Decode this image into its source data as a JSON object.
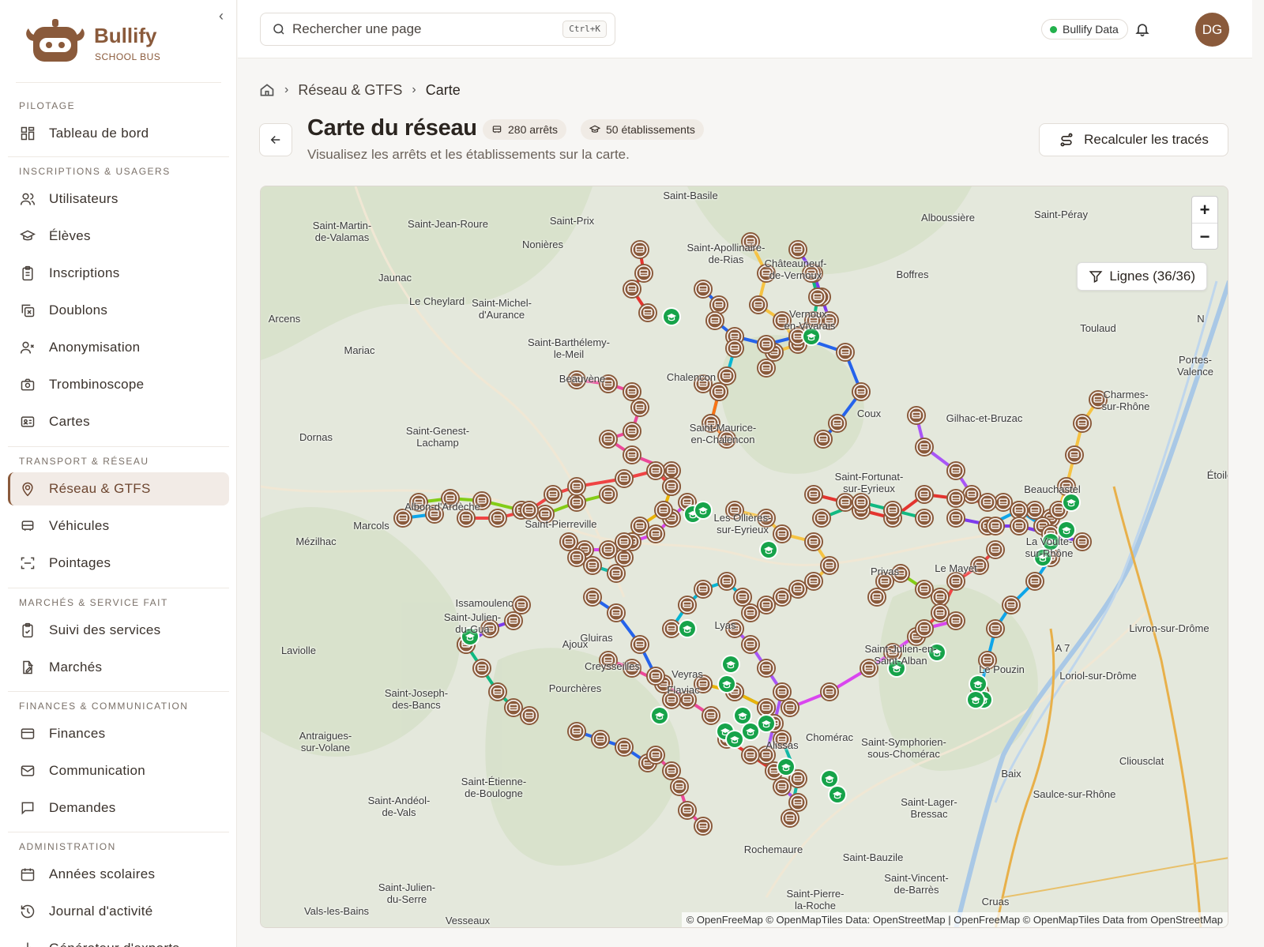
{
  "brand": {
    "name": "Bullify",
    "sub": "SCHOOL BUS",
    "color": "#8a5a3b"
  },
  "sidebar": {
    "sections": [
      {
        "title": "PILOTAGE",
        "items": [
          {
            "label": "Tableau de bord",
            "icon": "dashboard-icon"
          }
        ]
      },
      {
        "title": "INSCRIPTIONS & USAGERS",
        "items": [
          {
            "label": "Utilisateurs",
            "icon": "users-icon"
          },
          {
            "label": "Élèves",
            "icon": "graduation-cap-icon"
          },
          {
            "label": "Inscriptions",
            "icon": "clipboard-icon"
          },
          {
            "label": "Doublons",
            "icon": "duplicate-icon"
          },
          {
            "label": "Anonymisation",
            "icon": "user-x-icon"
          },
          {
            "label": "Trombinoscope",
            "icon": "camera-icon"
          },
          {
            "label": "Cartes",
            "icon": "id-card-icon"
          }
        ]
      },
      {
        "title": "TRANSPORT & RÉSEAU",
        "items": [
          {
            "label": "Réseau & GTFS",
            "icon": "map-pin-icon",
            "active": true
          },
          {
            "label": "Véhicules",
            "icon": "bus-icon"
          },
          {
            "label": "Pointages",
            "icon": "scan-icon"
          }
        ]
      },
      {
        "title": "MARCHÉS & SERVICE FAIT",
        "items": [
          {
            "label": "Suivi des services",
            "icon": "clipboard-check-icon"
          },
          {
            "label": "Marchés",
            "icon": "file-edit-icon"
          }
        ]
      },
      {
        "title": "FINANCES & COMMUNICATION",
        "items": [
          {
            "label": "Finances",
            "icon": "credit-card-icon"
          },
          {
            "label": "Communication",
            "icon": "mail-icon"
          },
          {
            "label": "Demandes",
            "icon": "message-icon"
          }
        ]
      },
      {
        "title": "ADMINISTRATION",
        "items": [
          {
            "label": "Années scolaires",
            "icon": "calendar-icon"
          },
          {
            "label": "Journal d'activité",
            "icon": "history-icon"
          },
          {
            "label": "Générateur d'exports",
            "icon": "download-icon"
          }
        ]
      }
    ]
  },
  "topbar": {
    "search_placeholder": "Rechercher une page",
    "shortcut": "Ctrl+K",
    "data_label": "Bullify Data",
    "avatar_initials": "DG"
  },
  "breadcrumb": {
    "parent": "Réseau & GTFS",
    "current": "Carte"
  },
  "page": {
    "title": "Carte du réseau",
    "stops_badge": "280 arrêts",
    "schools_badge": "50 établissements",
    "subtitle": "Visualisez les arrêts et les établissements sur la carte.",
    "recalc_label": "Recalculer les tracés"
  },
  "map": {
    "lines_filter": "Lignes (36/36)",
    "attribution": "© OpenFreeMap © OpenMapTiles Data: OpenStreetMap | OpenFreeMap © OpenMapTiles Data from OpenStreetMap",
    "places": [
      "Saint-Basile",
      "Saint-Martin-\nde-Valamas",
      "Saint-Jean-Roure",
      "Saint-Prix",
      "Alboussière",
      "Saint-Péray",
      "Nonières",
      "Saint-Apollinaire-\nde-Rias",
      "Châteauneuf-\nde-Vernoux",
      "Boffres",
      "Jaunac",
      "Le Cheylard",
      "Saint-Michel-\nd'Aurance",
      "Vernoux-\nen-Vivarais",
      "Toulaud",
      "Mariac",
      "Saint-Barthélemy-\nle-Meil",
      "Portes-\nValence",
      "Charmes-\nsur-Rhône",
      "Gilhac-et-Bruzac",
      "Beauvène",
      "Chalencon",
      "Saint-Maurice-\nen-Chalencon",
      "Dornas",
      "Saint-Genest-\nLachamp",
      "Saint-Fortunat-\nsur-Eyrieux",
      "Étoile",
      "Albon-d'Ardèche",
      "Marcols",
      "Saint-Pierreville",
      "Beauchastel",
      "Mézilhac",
      "La Voulte-\nsur-Rhône",
      "Issamoulenc",
      "Saint-Julien-\ndu-Gua",
      "Ajoux",
      "Livron-sur-Drôme",
      "Laviolle",
      "Saint-Julien-en-\nSaint-Alban",
      "Pourchères",
      "Gluiras",
      "Loriol-sur-Drôme",
      "Saint-Joseph-\ndes-Bancs",
      "Le Pouzin",
      "Antraigues-\nsur-Volane",
      "Saint-Symphorien-\nsous-Chomérac",
      "Cliousclat",
      "Baix",
      "Saulce-sur-Rhône",
      "Saint-Étienne-\nde-Boulogne",
      "Saint-Andéol-\nde-Vals",
      "Saint-Lager-\nBressac",
      "Rochemaure",
      "Saint-Bauzile",
      "Saint-Julien-\ndu-Serre",
      "Vals-les-Bains",
      "Saint-Vincent-\nde-Barrès",
      "Saint-Pierre-\nla-Roche",
      "Cruas",
      "Vesseaux",
      "Privas",
      "Coux",
      "Lyas",
      "Flaviac",
      "Chomérac",
      "Alissas",
      "Veyras",
      "Creysseilles",
      "Les Ollières-\nsur-Eyrieux",
      "Arcens",
      "Le Mayet",
      "A 7",
      "N"
    ],
    "line_colors": [
      "#e3342f",
      "#f6c343",
      "#7c3aed",
      "#10b981",
      "#2563eb",
      "#ec4899",
      "#06b6d4",
      "#f97316",
      "#a855f7",
      "#84cc16",
      "#ef4444",
      "#0ea5e9",
      "#d946ef",
      "#14b8a6",
      "#eab308"
    ],
    "stop_color": "#8a5a3b",
    "school_color": "#16a34a"
  }
}
